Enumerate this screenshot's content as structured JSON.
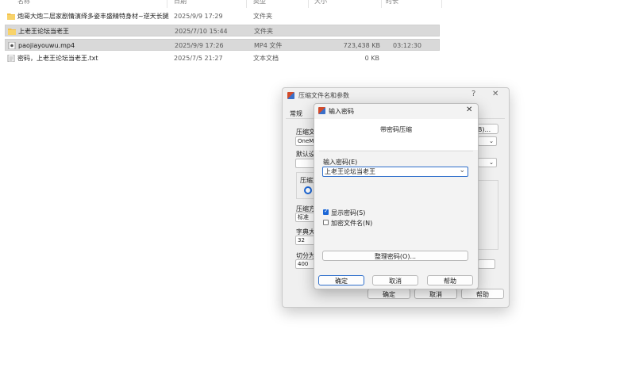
{
  "file_list": {
    "headers": {
      "name": "名称",
      "date": "日期",
      "type": "类型",
      "size": "大小",
      "duration": "时长"
    },
    "rows": [
      {
        "name": "炮哥大炮二层家剧情演绎多姿丰盛精特身材~逆天长腿",
        "date": "2025/9/9 17:29",
        "type": "文件夹",
        "size": "",
        "duration": "",
        "icon": "folder-icon",
        "selected": false
      },
      {
        "name": "上老王论坛当老王",
        "date": "2025/7/10 15:44",
        "type": "文件夹",
        "size": "",
        "duration": "",
        "icon": "folder-icon",
        "selected": true
      },
      {
        "name": "paojiayouwu.mp4",
        "date": "2025/9/9 17:26",
        "type": "MP4 文件",
        "size": "723,438 KB",
        "duration": "03:12:30",
        "icon": "video-file-icon",
        "selected": true
      },
      {
        "name": "密码，上老王论坛当老王.txt",
        "date": "2025/7/5 21:27",
        "type": "文本文档",
        "size": "0 KB",
        "duration": "",
        "icon": "text-file-icon",
        "selected": false
      }
    ]
  },
  "archive_dialog": {
    "title": "压缩文件名和参数",
    "help_glyph": "?",
    "close_glyph": "✕",
    "tab_general": "常规",
    "label_archive": "压缩文",
    "archive_value": "OneMo",
    "browse_fragment": "B)...",
    "label_default": "默认设",
    "label_format": "压缩文",
    "label_method": "压缩方",
    "method_value": "标准",
    "label_dict": "字典大",
    "dict_value": "32",
    "label_split": "切分为",
    "split_value": "400",
    "ok": "确定",
    "cancel": "取消",
    "help": "帮助"
  },
  "password_dialog": {
    "title": "输入密码",
    "close_glyph": "✕",
    "heading": "带密码压缩",
    "label_password": "输入密码(E)",
    "password_value": "上老王论坛当老王",
    "show_password": "显示密码(S)",
    "show_password_checked": true,
    "encrypt_filenames": "加密文件名(N)",
    "encrypt_filenames_checked": false,
    "organize": "整理密码(O)...",
    "ok": "确定",
    "cancel": "取消",
    "help": "帮助"
  }
}
